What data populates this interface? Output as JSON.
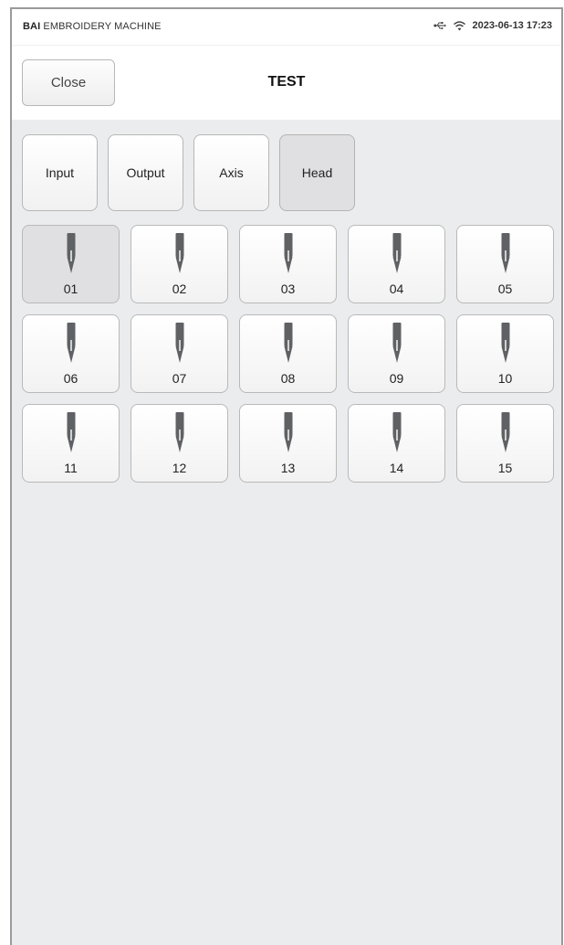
{
  "status_bar": {
    "brand_bold": "BAI",
    "brand_rest": " EMBROIDERY MACHINE",
    "datetime": "2023-06-13 17:23",
    "icons": [
      "usb-icon",
      "wifi-icon"
    ]
  },
  "header": {
    "close_label": "Close",
    "title": "TEST"
  },
  "tabs": [
    {
      "label": "Input",
      "active": false
    },
    {
      "label": "Output",
      "active": false
    },
    {
      "label": "Axis",
      "active": false
    },
    {
      "label": "Head",
      "active": true
    }
  ],
  "heads": [
    {
      "label": "01",
      "active": true
    },
    {
      "label": "02",
      "active": false
    },
    {
      "label": "03",
      "active": false
    },
    {
      "label": "04",
      "active": false
    },
    {
      "label": "05",
      "active": false
    },
    {
      "label": "06",
      "active": false
    },
    {
      "label": "07",
      "active": false
    },
    {
      "label": "08",
      "active": false
    },
    {
      "label": "09",
      "active": false
    },
    {
      "label": "10",
      "active": false
    },
    {
      "label": "11",
      "active": false
    },
    {
      "label": "12",
      "active": false
    },
    {
      "label": "13",
      "active": false
    },
    {
      "label": "14",
      "active": false
    },
    {
      "label": "15",
      "active": false
    }
  ],
  "colors": {
    "needle": "#5f6164",
    "panel_bg": "#ebecee",
    "active_bg": "#e0e0e2"
  }
}
